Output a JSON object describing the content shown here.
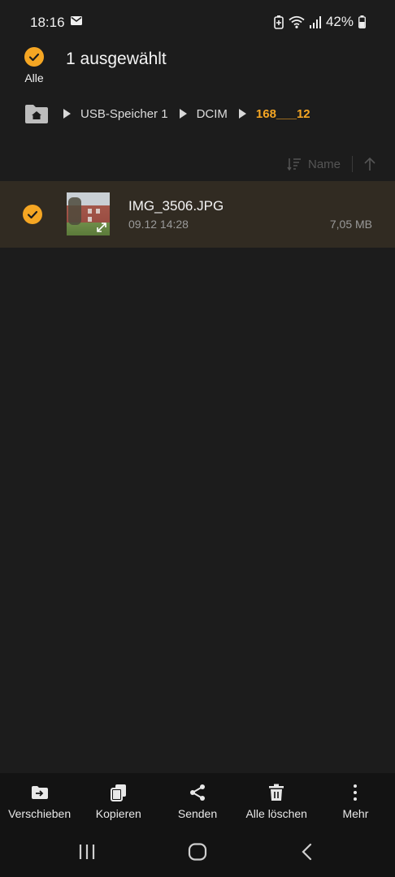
{
  "status_bar": {
    "time": "18:16",
    "battery_percent": "42%",
    "icons": [
      "mail-icon",
      "battery-saver-icon",
      "wifi-icon",
      "signal-icon",
      "battery-icon"
    ]
  },
  "header": {
    "select_all_label": "Alle",
    "title": "1 ausgewählt"
  },
  "breadcrumb": {
    "items": [
      "USB-Speicher 1",
      "DCIM",
      "168___12"
    ]
  },
  "sort": {
    "label": "Name"
  },
  "files": [
    {
      "name": "IMG_3506.JPG",
      "date": "09.12 14:28",
      "size": "7,05 MB",
      "selected": true
    }
  ],
  "actions": [
    {
      "label": "Verschieben",
      "icon": "move-icon"
    },
    {
      "label": "Kopieren",
      "icon": "copy-icon"
    },
    {
      "label": "Senden",
      "icon": "share-icon"
    },
    {
      "label": "Alle löschen",
      "icon": "delete-icon"
    },
    {
      "label": "Mehr",
      "icon": "more-icon"
    }
  ],
  "colors": {
    "accent": "#f5a623",
    "background": "#1c1c1c",
    "selected_row": "#312b22",
    "bottom_bar": "#131313"
  }
}
